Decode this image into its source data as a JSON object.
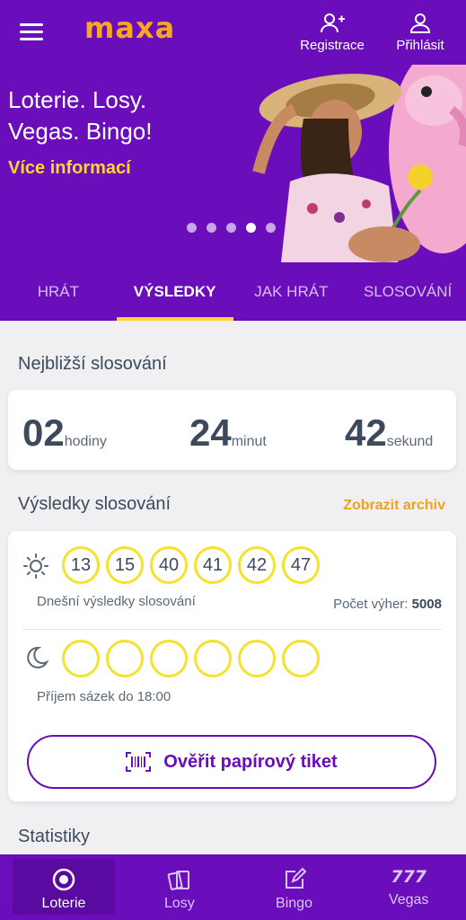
{
  "header": {
    "logo": "maxa",
    "register_label": "Registrace",
    "login_label": "Přihlásit"
  },
  "hero": {
    "title_line1": "Loterie. Losy.",
    "title_line2": "Vegas. Bingo!",
    "link": "Více informací",
    "slides_count": 5,
    "active_slide": 4
  },
  "tabs": [
    "HRÁT",
    "VÝSLEDKY",
    "JAK HRÁT",
    "SLOSOVÁNÍ"
  ],
  "active_tab": "VÝSLEDKY",
  "next_draw": {
    "title": "Nejbližší slosování",
    "hours_value": "02",
    "hours_unit": "hodiny",
    "minutes_value": "24",
    "minutes_unit": "minut",
    "seconds_value": "42",
    "seconds_unit": "sekund"
  },
  "results": {
    "title": "Výsledky slosování",
    "archive_link": "Zobrazit archiv",
    "day_numbers": [
      "13",
      "15",
      "40",
      "41",
      "42",
      "47"
    ],
    "day_caption": "Dnešní výsledky slosování",
    "wins_label": "Počet výher:",
    "wins_value": "5008",
    "night_numbers": [
      "",
      "",
      "",
      "",
      "",
      ""
    ],
    "night_caption": "Příjem sázek do 18:00",
    "verify_button": "Ověřit papírový tiket"
  },
  "statistics_title": "Statistiky",
  "bottom_nav": {
    "items": [
      {
        "label": "Loterie",
        "icon": "lottery-ball-icon"
      },
      {
        "label": "Losy",
        "icon": "scratch-tickets-icon"
      },
      {
        "label": "Bingo",
        "icon": "bingo-pencil-icon"
      },
      {
        "label": "Vegas",
        "icon": "777-slots-icon"
      }
    ],
    "active": "Loterie"
  },
  "colors": {
    "brand_purple": "#6a0dbb",
    "logo_orange": "#f6a623",
    "accent_yellow": "#ffd335",
    "ball_yellow": "#f5e22c",
    "archive_orange": "#f0a11e"
  }
}
